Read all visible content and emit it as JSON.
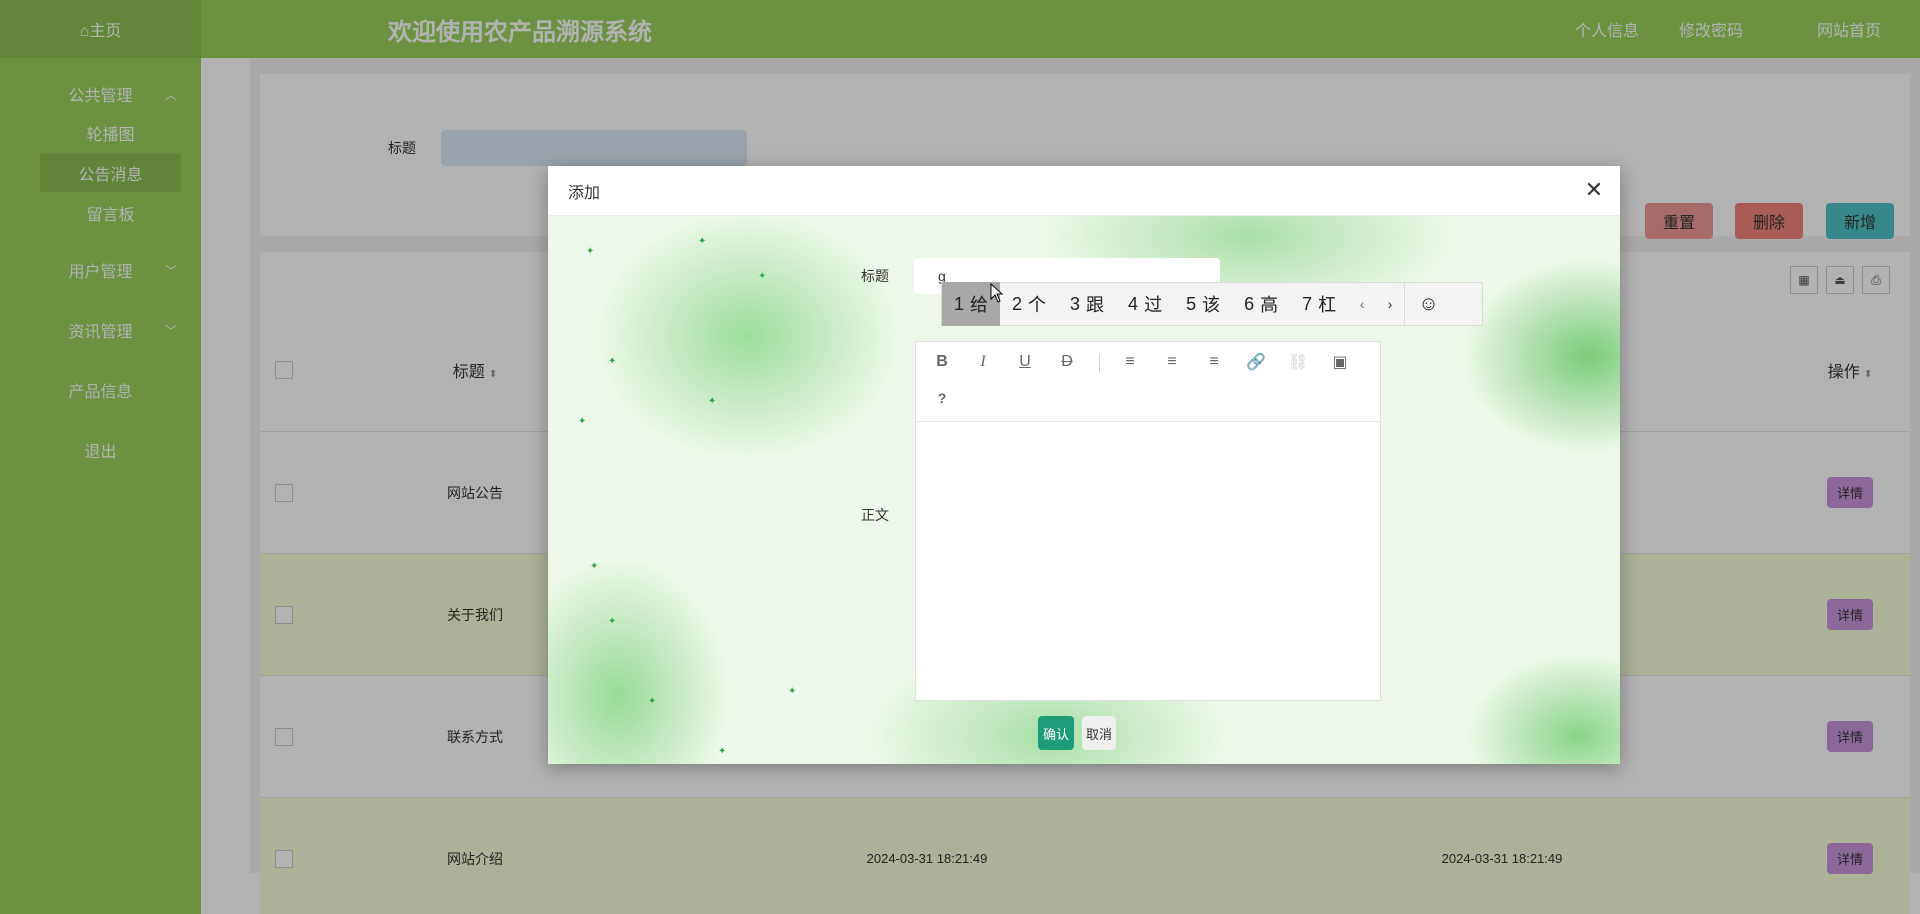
{
  "sidebar": {
    "home": "⌂主页",
    "groups": [
      {
        "label": "公共管理",
        "chevron": "up",
        "items": [
          "轮播图",
          "公告消息",
          "留言板"
        ],
        "active": "公告消息"
      },
      {
        "label": "用户管理",
        "chevron": "down"
      },
      {
        "label": "资讯管理",
        "chevron": "down"
      }
    ],
    "product": "产品信息",
    "logout": "退出"
  },
  "header": {
    "title": "欢迎使用农产品溯源系统",
    "links": [
      "个人信息",
      "修改密码",
      "网站首页"
    ]
  },
  "search": {
    "label": "标题",
    "buttons": {
      "reset": "重置",
      "delete": "删除",
      "add": "新增"
    }
  },
  "table": {
    "headers": {
      "title": "标题",
      "op": "操作"
    },
    "rows": [
      {
        "title": "网站公告",
        "c1": "",
        "c2": ""
      },
      {
        "title": "关于我们",
        "c1": "",
        "c2": ""
      },
      {
        "title": "联系方式",
        "c1": "",
        "c2": ""
      },
      {
        "title": "网站介绍",
        "c1": "2024-03-31 18:21:49",
        "c2": "2024-03-31 18:21:49"
      }
    ],
    "detail": "详情"
  },
  "modal": {
    "title": "添加",
    "field_title_label": "标题",
    "field_title_value": "g",
    "field_body_label": "正文",
    "confirm": "确认",
    "cancel": "取消",
    "toolbar_help": "?"
  },
  "ime": {
    "candidates": [
      {
        "n": "1",
        "c": "给"
      },
      {
        "n": "2",
        "c": "个"
      },
      {
        "n": "3",
        "c": "跟"
      },
      {
        "n": "4",
        "c": "过"
      },
      {
        "n": "5",
        "c": "该"
      },
      {
        "n": "6",
        "c": "高"
      },
      {
        "n": "7",
        "c": "杠"
      }
    ]
  },
  "colors": {
    "brand": "#9ad15c",
    "confirm": "#1f9d7a",
    "detail": "#c895dc"
  }
}
